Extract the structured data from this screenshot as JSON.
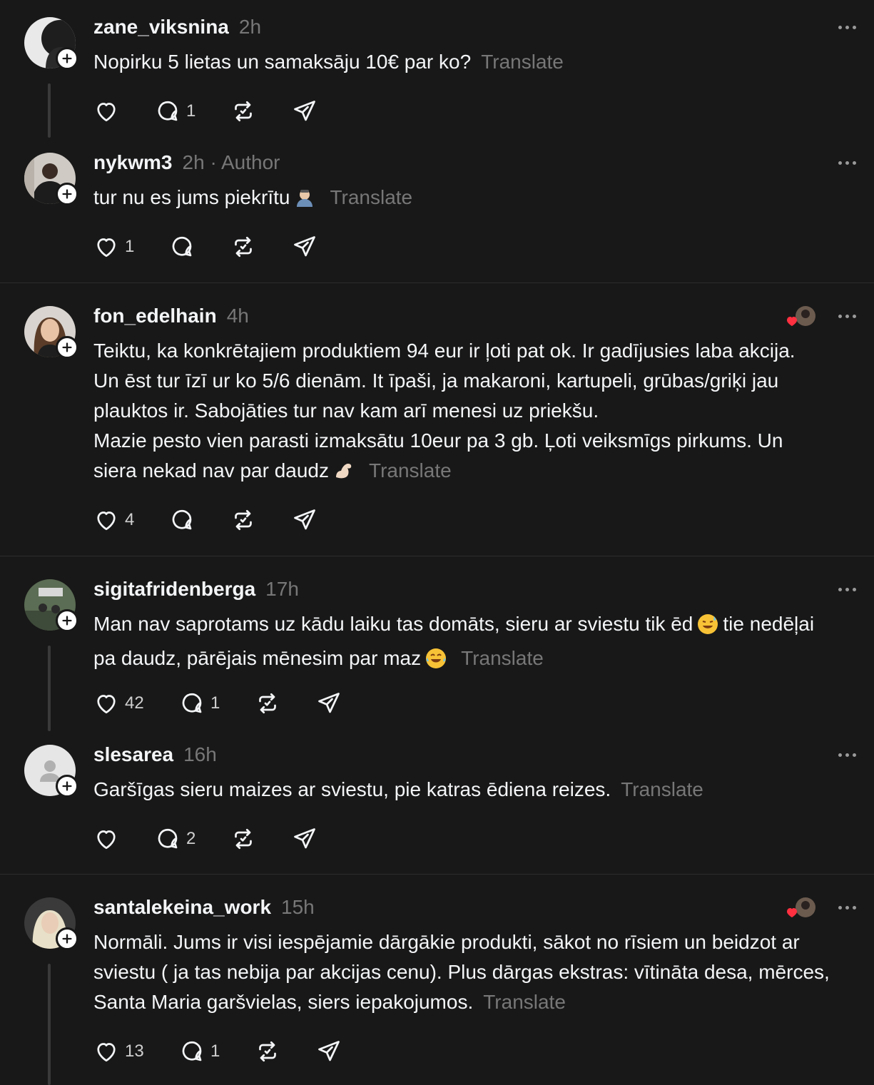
{
  "translate_label": "Translate",
  "posts": [
    {
      "username": "zane_viksnina",
      "time": "2h",
      "author": "",
      "text": "Nopirku 5 lietas un samaksāju 10€ par ko?",
      "likes": "",
      "replies": "1"
    },
    {
      "username": "nykwm3",
      "time": "2h",
      "author": "· Author",
      "text": "tur nu es jums piekrītu",
      "likes": "1",
      "replies": ""
    },
    {
      "username": "fon_edelhain",
      "time": "4h",
      "author": "",
      "text_lines": [
        "Teiktu, ka konkrētajiem produktiem 94 eur ir ļoti pat ok. Ir gadījusies laba akcija.",
        "Un ēst tur īzī ur ko 5/6 dienām. It īpaši, ja makaroni, kartupeli, grūbas/griķi jau",
        "plauktos ir. Sabojāties tur nav kam arī menesi uz priekšu.",
        "Mazie pesto vien parasti izmaksātu 10eur pa 3 gb. Ļoti veiksmīgs pirkums. Un",
        "siera nekad nav par daudz"
      ],
      "likes": "4",
      "replies": ""
    },
    {
      "username": "sigitafridenberga",
      "time": "17h",
      "author": "",
      "text_line1": "Man nav saprotams uz kādu laiku tas domāts, sieru ar sviestu tik ēd",
      "text_line1b": "tie nedēļai",
      "text_line2": "pa daudz, pārējais mēnesim par maz",
      "likes": "42",
      "replies": "1"
    },
    {
      "username": "slesarea",
      "time": "16h",
      "author": "",
      "text": "Garšīgas sieru maizes ar sviestu, pie katras ēdiena reizes.",
      "likes": "",
      "replies": "2"
    },
    {
      "username": "santalekeina_work",
      "time": "15h",
      "author": "",
      "text_lines": [
        "Normāli. Jums ir visi iespējamie dārgākie produkti, sākot no rīsiem un beidzot ar",
        "sviestu ( ja tas nebija par akcijas cenu). Plus dārgas ekstras: vītināta desa, mērces,",
        "Santa Maria garšvielas, siers iepakojumos."
      ],
      "likes": "13",
      "replies": "1"
    }
  ],
  "colors": {
    "background": "#181818",
    "text": "#f3f5f7",
    "muted": "#777777",
    "heart_red": "#ff3040"
  },
  "icons": [
    "heart-icon",
    "comment-icon",
    "repost-icon",
    "share-icon",
    "more-icon",
    "plus-icon"
  ]
}
